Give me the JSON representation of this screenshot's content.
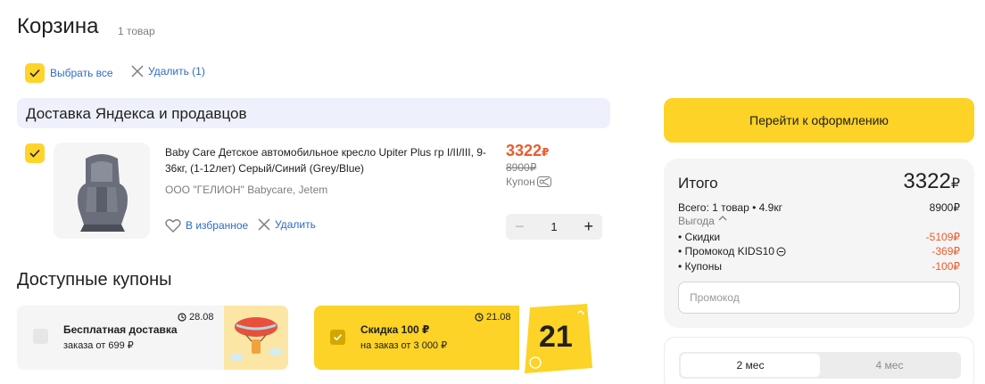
{
  "header": {
    "title": "Корзина",
    "count": "1 товар"
  },
  "toolbar": {
    "select_all": "Выбрать все",
    "delete_selected": "Удалить (1)"
  },
  "delivery": {
    "title": "Доставка Яндекса и продавцов"
  },
  "item": {
    "title": "Baby Care Детское автомобильное кресло Upiter Plus гр I/II/III, 9-36кг, (1-12лет) Серый/Синий (Grey/Blue)",
    "seller": "ООО \"ГЕЛИОН\" Babycare, Jetem",
    "price": "3322",
    "old_price": "8900",
    "currency": "₽",
    "coupon_label": "Купон",
    "favorite": "В избранное",
    "delete": "Удалить",
    "quantity": "1",
    "minus": "−",
    "plus": "+",
    "image_icon": "car-seat-icon"
  },
  "coupons": {
    "title": "Доступные купоны",
    "items": [
      {
        "name": "Бесплатная доставка",
        "desc": "заказа от 699 ₽",
        "date": "28.08",
        "selected": false,
        "icon": "airship-icon"
      },
      {
        "name": "Скидка 100 ₽",
        "desc": "на заказ от 3 000 ₽",
        "date": "21.08",
        "selected": true,
        "badge": "21"
      }
    ]
  },
  "checkout": {
    "button": "Перейти к оформлению"
  },
  "summary": {
    "title": "Итого",
    "total": "3322",
    "currency": "₽",
    "all_label": "Всего: 1 товар • 4.9кг",
    "all_value": "8900₽",
    "benefit_label": "Выгода",
    "rows": [
      {
        "label": "• Скидки",
        "value": "-5109₽"
      },
      {
        "label": "• Промокод KIDS10",
        "value": "-369₽"
      },
      {
        "label": "• Купоны",
        "value": "-100₽"
      }
    ],
    "promo_placeholder": "Промокод"
  },
  "plans": {
    "tabs": [
      "2 мес",
      "4 мес"
    ],
    "active": 0
  },
  "colors": {
    "accent": "#fcd326",
    "price": "#ec5b2c",
    "link": "#2e6cc1",
    "panel": "#f5f5f5"
  }
}
